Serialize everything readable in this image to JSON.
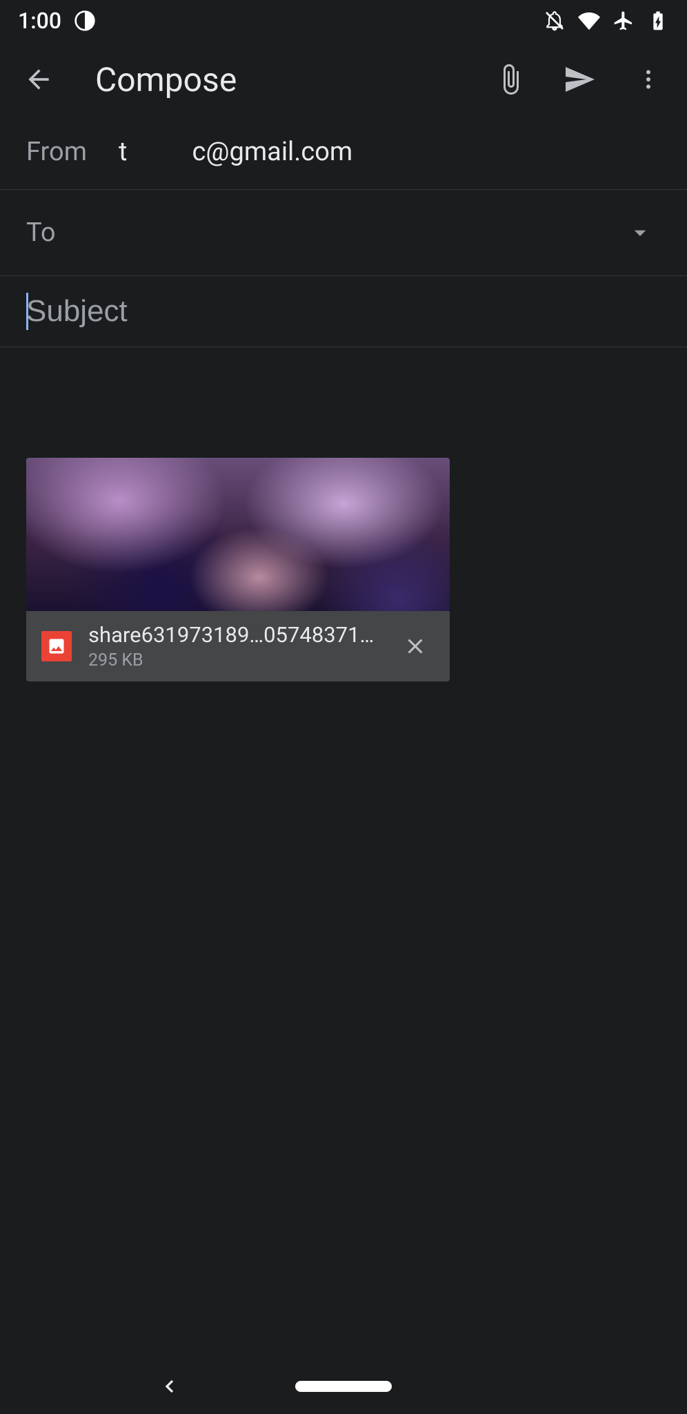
{
  "status_bar": {
    "time": "1:00"
  },
  "app_bar": {
    "title": "Compose"
  },
  "compose": {
    "from_label": "From",
    "from_value_left": "t",
    "from_value_right": "c@gmail.com",
    "to_label": "To",
    "subject_placeholder": "Subject",
    "subject_value": ""
  },
  "attachment": {
    "name": "share631973189…05748371.png",
    "size": "295 KB"
  }
}
